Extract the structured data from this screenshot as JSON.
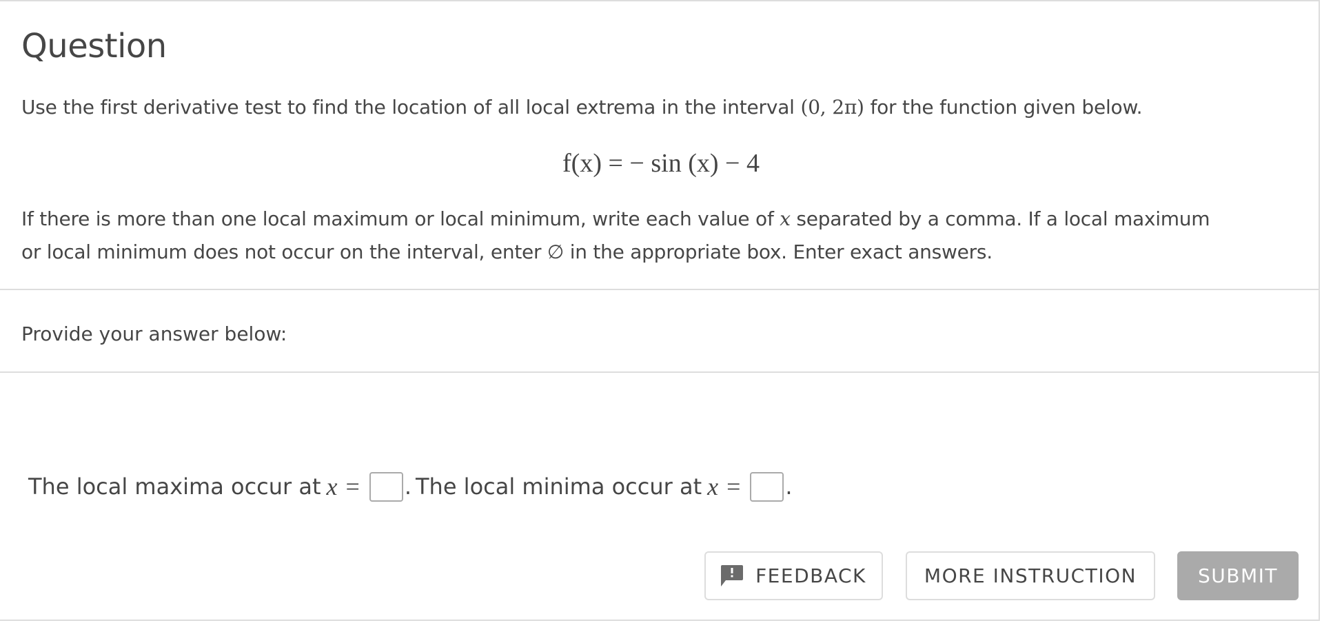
{
  "question": {
    "title": "Question",
    "prompt_before": "Use the first derivative test to find the location of all local extrema in the interval ",
    "interval": "(0, 2π)",
    "prompt_after": " for the function given below.",
    "formula": "f(x) = − sin (x) − 4",
    "instructions_line1_before": "If there is more than one local maximum or local minimum, write each value of ",
    "instructions_var": "x",
    "instructions_line1_after": " separated by a comma. If a local maximum",
    "instructions_line2": "or local minimum does not occur on the interval, enter ∅ in the appropriate box. Enter exact answers."
  },
  "provide": {
    "label": "Provide your answer below:"
  },
  "answer": {
    "maxima_label": "The local maxima occur at",
    "minima_label": "The local minima occur at",
    "variable": "x",
    "equals": "=",
    "maxima_value": "",
    "minima_value": "",
    "period": "."
  },
  "buttons": {
    "feedback": "FEEDBACK",
    "more_instruction": "MORE INSTRUCTION",
    "submit": "SUBMIT"
  },
  "icons": {
    "feedback": "feedback-speech-bubble-icon"
  },
  "colors": {
    "text": "#464646",
    "border": "#dddddd",
    "submit_disabled_bg": "#aaaaaa",
    "submit_text": "#ffffff"
  }
}
